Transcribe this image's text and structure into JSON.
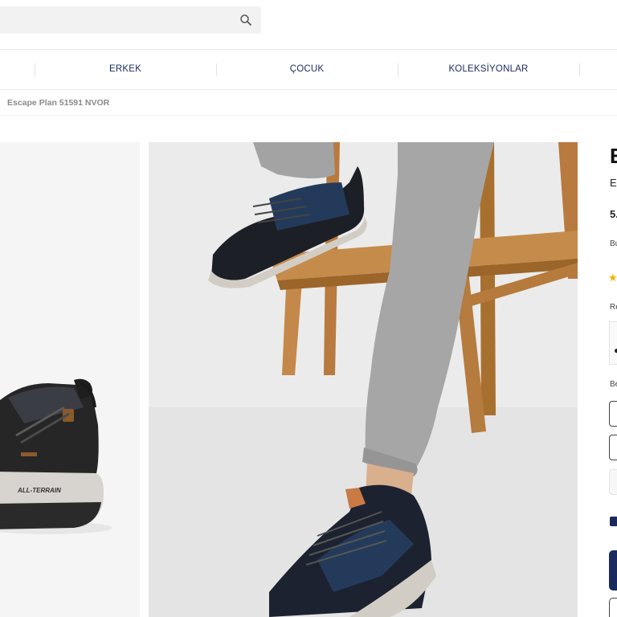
{
  "search": {
    "value": "",
    "placeholder": "",
    "icon": "search-icon"
  },
  "nav": {
    "items": [
      {
        "label": "ERKEK"
      },
      {
        "label": "ÇOCUK"
      },
      {
        "label": "KOLEKSİYONLAR"
      }
    ]
  },
  "breadcrumb": {
    "current": "Escape Plan 51591 NVOR"
  },
  "product": {
    "title_fragment": "E",
    "subtitle_fragment": "Er",
    "price_fragment": "5.",
    "note_fragment": "Bu",
    "rating_star": "★",
    "rating_label_fragment": "Re",
    "color_swatch_fragment": "●",
    "size_label_fragment": "Be"
  },
  "images": {
    "left": {
      "description_icon": "shoe-side-view"
    },
    "main": {
      "description_icon": "model-wearing-shoes"
    }
  },
  "colors": {
    "brand_navy": "#1b2a5e",
    "star": "#f0b400",
    "search_bg": "#f2f2f2"
  }
}
